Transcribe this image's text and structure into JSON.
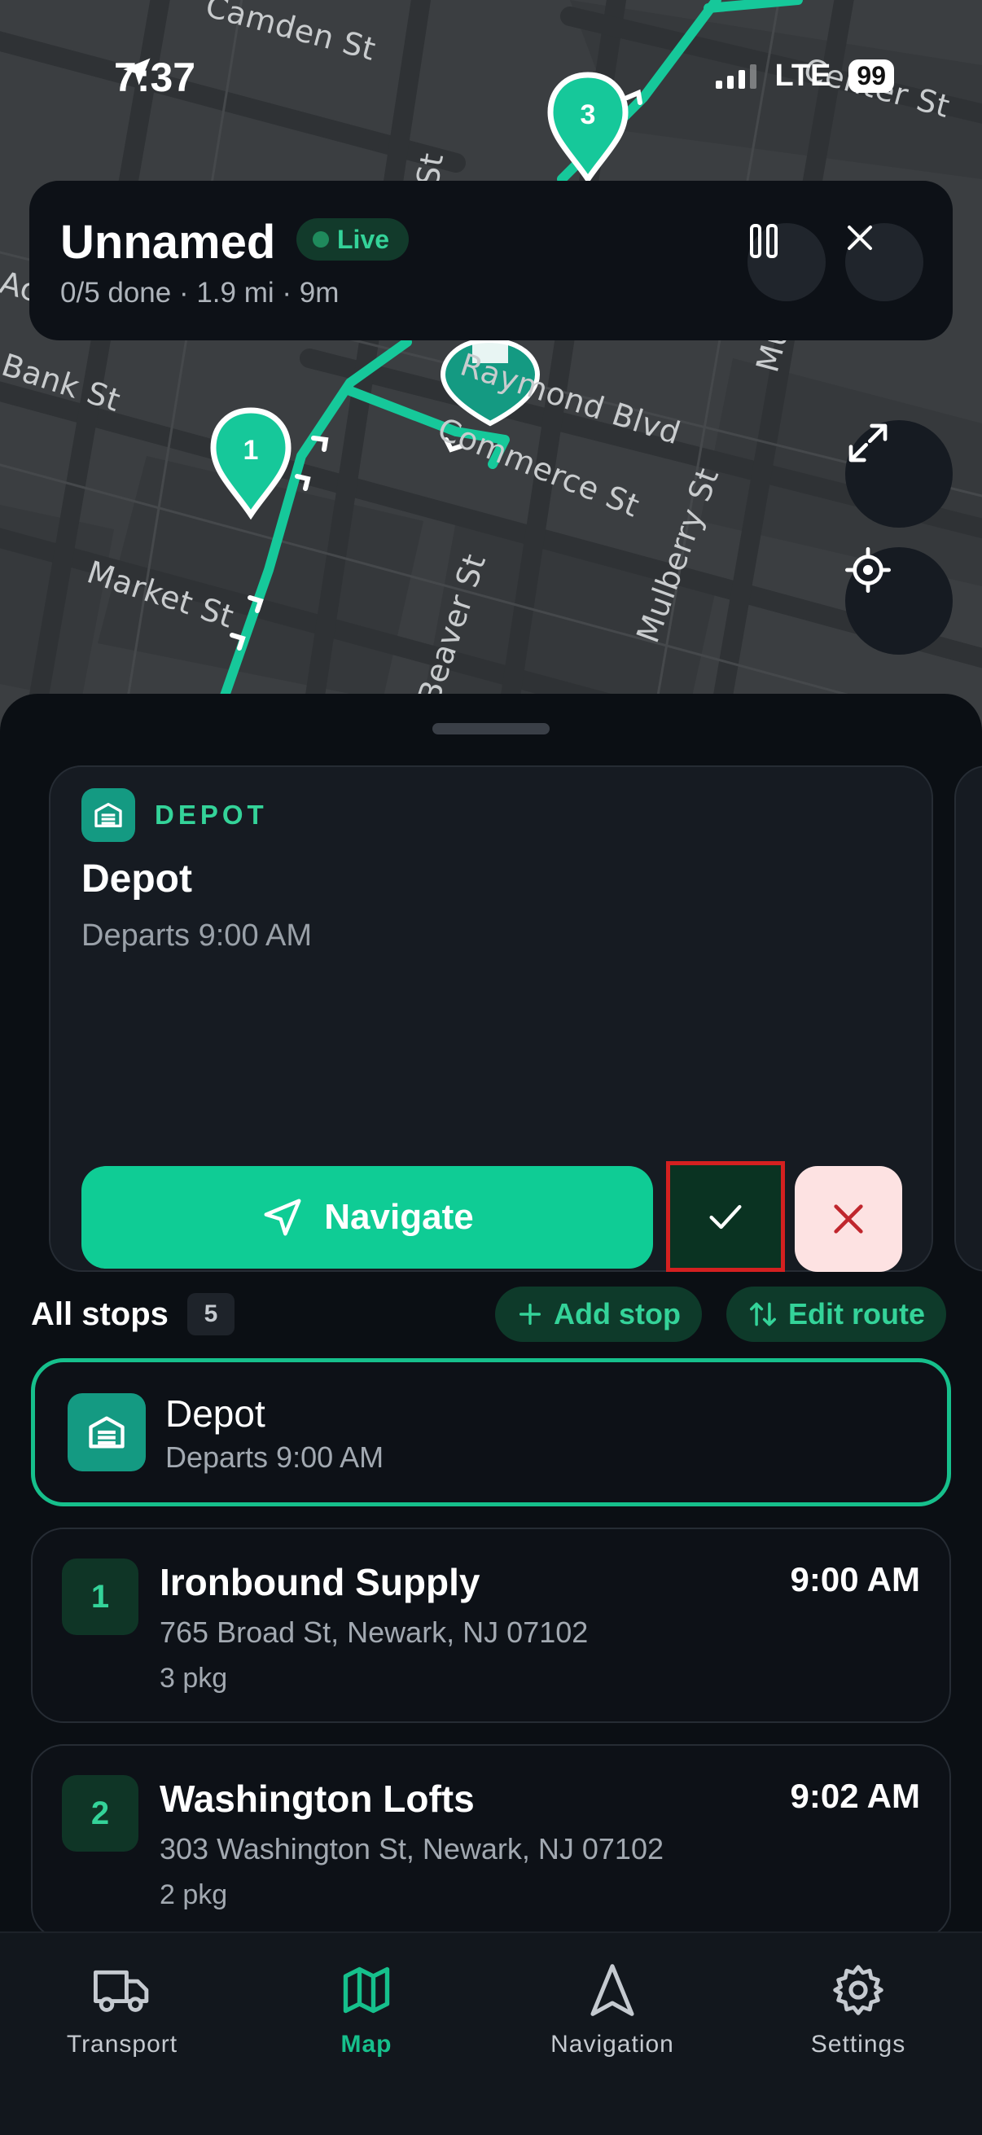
{
  "status_bar": {
    "time": "7:37",
    "network": "LTE",
    "battery": "99"
  },
  "map": {
    "streets": [
      {
        "name": "Camden St"
      },
      {
        "name": "Bank St"
      },
      {
        "name": "Market St"
      },
      {
        "name": "Raymond Blvd"
      },
      {
        "name": "Commerce St"
      },
      {
        "name": "Beaver St"
      },
      {
        "name": "Mulberry St"
      },
      {
        "name": "Center St"
      },
      {
        "name": "St"
      },
      {
        "name": "Mu"
      },
      {
        "name": "Ac"
      }
    ],
    "markers": [
      {
        "label": "1"
      },
      {
        "label": "3"
      }
    ]
  },
  "trip": {
    "title": "Unnamed",
    "live_label": "Live",
    "summary": "0/5 done · 1.9 mi · 9m"
  },
  "current_stop": {
    "tag": "DEPOT",
    "name": "Depot",
    "subtitle": "Departs 9:00 AM",
    "navigate_label": "Navigate"
  },
  "stops_section": {
    "title": "All stops",
    "count": "5",
    "add_label": "Add stop",
    "edit_label": "Edit route"
  },
  "stops": [
    {
      "name": "Depot",
      "subtitle": "Departs 9:00 AM"
    },
    {
      "number": "1",
      "name": "Ironbound Supply",
      "address": "765 Broad St, Newark, NJ 07102",
      "packages": "3 pkg",
      "time": "9:00 AM"
    },
    {
      "number": "2",
      "name": "Washington Lofts",
      "address": "303 Washington St, Newark, NJ 07102",
      "packages": "2 pkg",
      "time": "9:02 AM"
    }
  ],
  "tabs": [
    {
      "label": "Transport",
      "icon": "truck-icon"
    },
    {
      "label": "Map",
      "icon": "map-icon"
    },
    {
      "label": "Navigation",
      "icon": "navigation-arrow-icon"
    },
    {
      "label": "Settings",
      "icon": "gear-icon"
    }
  ],
  "colors": {
    "accent": "#16c08c",
    "live_text": "#34d399",
    "skip_bg": "#fde2e2",
    "skip_x": "#c0262d",
    "highlight_border": "#d42020"
  }
}
